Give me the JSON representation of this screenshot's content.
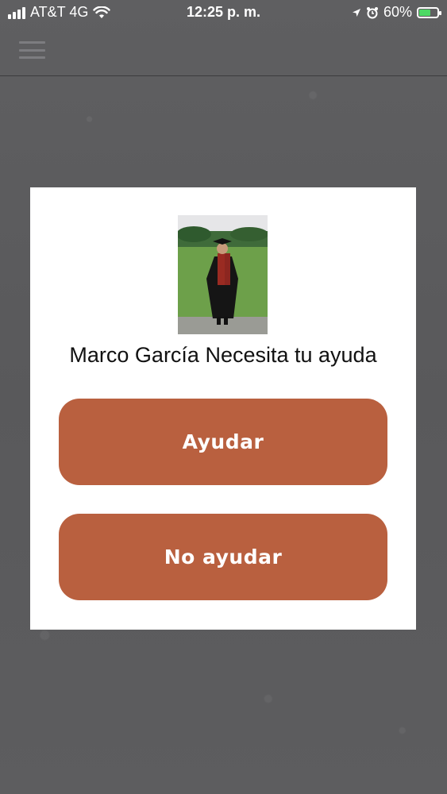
{
  "status_bar": {
    "carrier": "AT&T 4G",
    "time": "12:25 p. m.",
    "battery_percent": "60%",
    "battery_level": 0.6
  },
  "modal": {
    "message": "Marco García Necesita tu ayuda",
    "help_button": "Ayudar",
    "no_help_button": "No ayudar"
  },
  "colors": {
    "accent": "#b9603f",
    "background": "#5b5b5d",
    "battery_charging": "#4cd964"
  }
}
